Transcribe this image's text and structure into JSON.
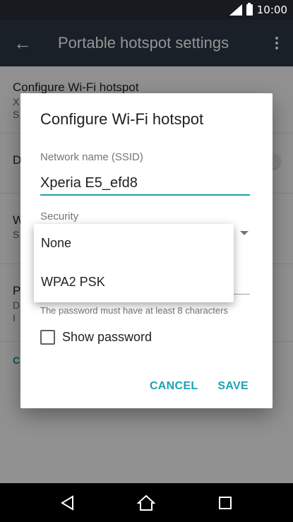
{
  "status_bar": {
    "time": "10:00"
  },
  "app_bar": {
    "title": "Portable hotspot settings"
  },
  "background_settings": [
    {
      "title": "Configure Wi-Fi hotspot",
      "subtitle": "X",
      "subtitle2": "S"
    },
    {
      "title": "D",
      "subtitle": ""
    },
    {
      "title": "W",
      "subtitle": "S"
    },
    {
      "title": "P",
      "subtitle": "D",
      "subtitle2": "I"
    },
    {
      "title": "C"
    }
  ],
  "dialog": {
    "title": "Configure Wi-Fi hotspot",
    "ssid_label": "Network name (SSID)",
    "ssid_value": "Xperia E5_efd8",
    "security_label": "Security",
    "password_hint": "The password must have at least 8 characters",
    "show_password_label": "Show password",
    "show_password_checked": false,
    "cancel_label": "CANCEL",
    "save_label": "SAVE"
  },
  "security_dropdown": {
    "options": [
      "None",
      "WPA2 PSK"
    ]
  },
  "colors": {
    "accent": "#1aa3b3",
    "app_bar": "#2c3845",
    "status_bar": "#171b20"
  },
  "nav_bar": {
    "icons": [
      "back-icon",
      "home-icon",
      "recents-icon"
    ]
  }
}
